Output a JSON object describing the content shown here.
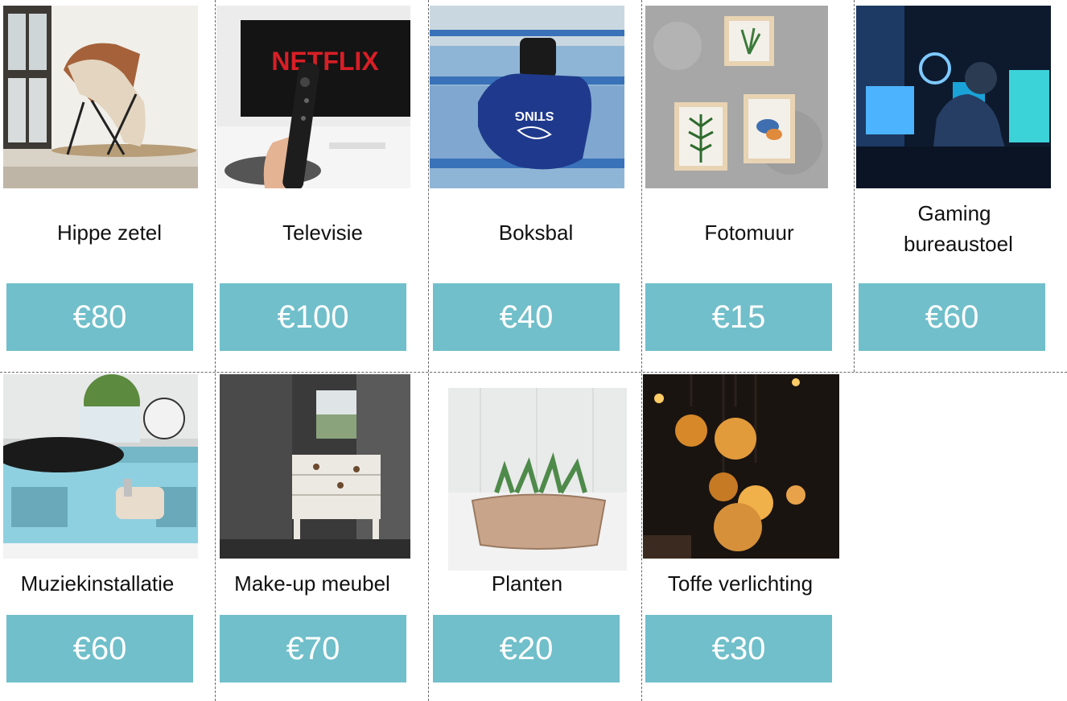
{
  "colors": {
    "price_background": "#70bfca",
    "price_text": "#ffffff",
    "divider": "#6a6a6a"
  },
  "items": [
    {
      "name": "Hippe zetel",
      "price": "€80",
      "image": "butterfly-chair"
    },
    {
      "name": "Televisie",
      "price": "€100",
      "image": "netflix-tv-remote",
      "tv_text": "NETFLIX"
    },
    {
      "name": "Boksbal",
      "price": "€40",
      "image": "boxing-glove",
      "glove_text": "STING"
    },
    {
      "name": "Fotomuur",
      "price": "€15",
      "image": "framed-plant-art"
    },
    {
      "name": "Gaming bureaustoel",
      "price": "€60",
      "image": "gaming-setup"
    },
    {
      "name": "Muziekinstallatie",
      "price": "€60",
      "image": "record-player"
    },
    {
      "name": "Make-up meubel",
      "price": "€70",
      "image": "vanity-dresser"
    },
    {
      "name": "Planten",
      "price": "€20",
      "image": "succulent-planter"
    },
    {
      "name": "Toffe verlichting",
      "price": "€30",
      "image": "edison-bulbs"
    }
  ]
}
